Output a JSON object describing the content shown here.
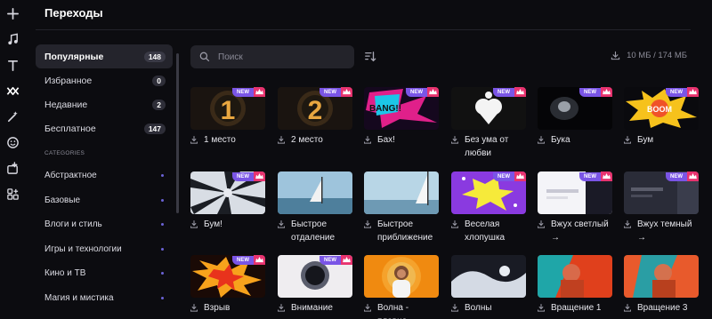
{
  "header": {
    "title": "Переходы"
  },
  "rail": {
    "icons": [
      "plus-icon",
      "music-icon",
      "text-icon",
      "transitions-icon",
      "effects-icon",
      "sticker-icon",
      "import-icon",
      "templates-icon"
    ]
  },
  "sidebar": {
    "items": [
      {
        "label": "Популярные",
        "count": "148"
      },
      {
        "label": "Избранное",
        "count": "0"
      },
      {
        "label": "Недавние",
        "count": "2"
      },
      {
        "label": "Бесплатное",
        "count": "147"
      }
    ],
    "categories_title": "CATEGORIES",
    "categories": [
      "Абстрактное",
      "Базовые",
      "Влоги и стиль",
      "Игры и технологии",
      "Кино и ТВ",
      "Магия и мистика"
    ]
  },
  "toolbar": {
    "search_placeholder": "Поиск",
    "storage": "10 МБ / 174 МБ"
  },
  "badge": {
    "new": "NEW"
  },
  "colors": {
    "accent": "#7a55e6",
    "premium": "#e8336f"
  },
  "items": [
    {
      "label": "1 место"
    },
    {
      "label": "2 место"
    },
    {
      "label": "Бах!"
    },
    {
      "label": "Без ума от любви"
    },
    {
      "label": "Бука"
    },
    {
      "label": "Бум"
    },
    {
      "label": "Бум!"
    },
    {
      "label": "Быстрое отдаление"
    },
    {
      "label": "Быстрое приближение"
    },
    {
      "label": "Веселая хлопушка"
    },
    {
      "label": "Вжух светлый →"
    },
    {
      "label": "Вжух темный →"
    },
    {
      "label": "Взрыв"
    },
    {
      "label": "Внимание"
    },
    {
      "label": "Волна - плавно"
    },
    {
      "label": "Волны"
    },
    {
      "label": "Вращение 1"
    },
    {
      "label": "Вращение 3"
    }
  ]
}
